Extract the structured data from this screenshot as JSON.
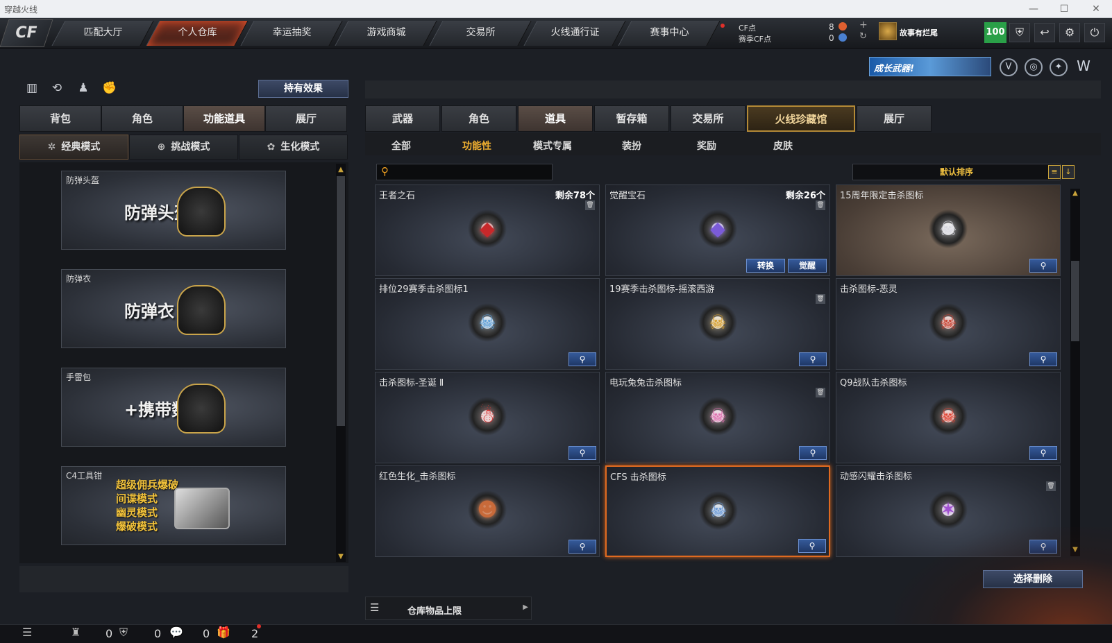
{
  "window": {
    "title": "穿越火线",
    "minimize": "—",
    "maximize": "☐",
    "close": "✕"
  },
  "nav": {
    "logo": "CF",
    "tabs": [
      "匹配大厅",
      "个人仓库",
      "幸运抽奖",
      "游戏商城",
      "交易所",
      "火线通行证",
      "赛事中心"
    ],
    "active_tab": "个人仓库"
  },
  "currency": {
    "cf_label": "CF点",
    "season_label": "赛季CF点",
    "cf_value": "8",
    "season_value": "0",
    "plus": "+",
    "refresh": "↻"
  },
  "user": {
    "name": "故事有烂尾",
    "level": "100"
  },
  "toolbar_icons": [
    "shield-icon",
    "return-icon",
    "gear-icon",
    "power-icon"
  ],
  "banner": {
    "growth_text": "成长武器!"
  },
  "left": {
    "hold_effect_button": "持有效果",
    "tabs": [
      "背包",
      "角色",
      "功能道具",
      "展厅"
    ],
    "active_tab": "功能道具",
    "mode_tabs": [
      {
        "label": "经典模式",
        "icon": "✲"
      },
      {
        "label": "挑战模式",
        "icon": "⊕"
      },
      {
        "label": "生化模式",
        "icon": "✿"
      }
    ],
    "items": [
      {
        "label": "防弹头盔",
        "big": "防弹头盔"
      },
      {
        "label": "防弹衣",
        "big": "防弹衣"
      },
      {
        "label": "手雷包",
        "big": "+携带数"
      },
      {
        "label": "C4工具钳",
        "lines": [
          "超级佣兵爆破",
          "间谍模式",
          "幽灵模式",
          "爆破模式"
        ]
      }
    ]
  },
  "right": {
    "tabs": [
      "武器",
      "角色",
      "道具",
      "暂存箱",
      "交易所",
      "火线珍藏馆",
      "展厅"
    ],
    "active_tab": "道具",
    "sub_tabs": [
      "全部",
      "功能性",
      "模式专属",
      "装扮",
      "奖励",
      "皮肤"
    ],
    "active_sub_tab": "功能性",
    "search_placeholder": "",
    "sort_label": "默认排序",
    "items": [
      {
        "name": "王者之石",
        "count": "剩余78个",
        "trash": true,
        "emblem": "◆",
        "color": "#c8282a"
      },
      {
        "name": "觉醒宝石",
        "count": "剩余26个",
        "trash": true,
        "emblem": "◆",
        "color": "#7b5bd8",
        "buttons": [
          "转换",
          "觉醒"
        ]
      },
      {
        "name": "15周年限定击杀图标",
        "emblem": "☠",
        "color": "#d8d8e0",
        "mag": true,
        "brown": true
      },
      {
        "name": "排位29赛季击杀图标1",
        "emblem": "☠",
        "color": "#5fa0d8",
        "mag": true
      },
      {
        "name": "19赛季击杀图标-摇滚西游",
        "trash": true,
        "emblem": "☠",
        "color": "#d8a030",
        "mag": true
      },
      {
        "name": "击杀图标-恶灵",
        "emblem": "☠",
        "color": "#c84030",
        "mag": true
      },
      {
        "name": "击杀图标-圣诞 Ⅱ",
        "emblem": "☃",
        "color": "#d83030",
        "mag": true
      },
      {
        "name": "电玩兔兔击杀图标",
        "trash": true,
        "emblem": "☠",
        "color": "#e070b0",
        "mag": true
      },
      {
        "name": "Q9战队击杀图标",
        "emblem": "☠",
        "color": "#e04030",
        "mag": true
      },
      {
        "name": "红色生化_击杀图标",
        "emblem": "☻",
        "color": "#c86a3a",
        "mag": true
      },
      {
        "name": "CFS 击杀图标",
        "emblem": "☠",
        "color": "#6a9ad8",
        "mag": true,
        "selected": true
      },
      {
        "name": "动感闪耀击杀图标",
        "trash": true,
        "emblem": "✶",
        "color": "#a050d0",
        "mag": true
      }
    ],
    "delete_button": "选择删除",
    "capacity_label": "仓库物品上限"
  },
  "status": {
    "values": [
      "0",
      "0",
      "0",
      "2"
    ]
  }
}
